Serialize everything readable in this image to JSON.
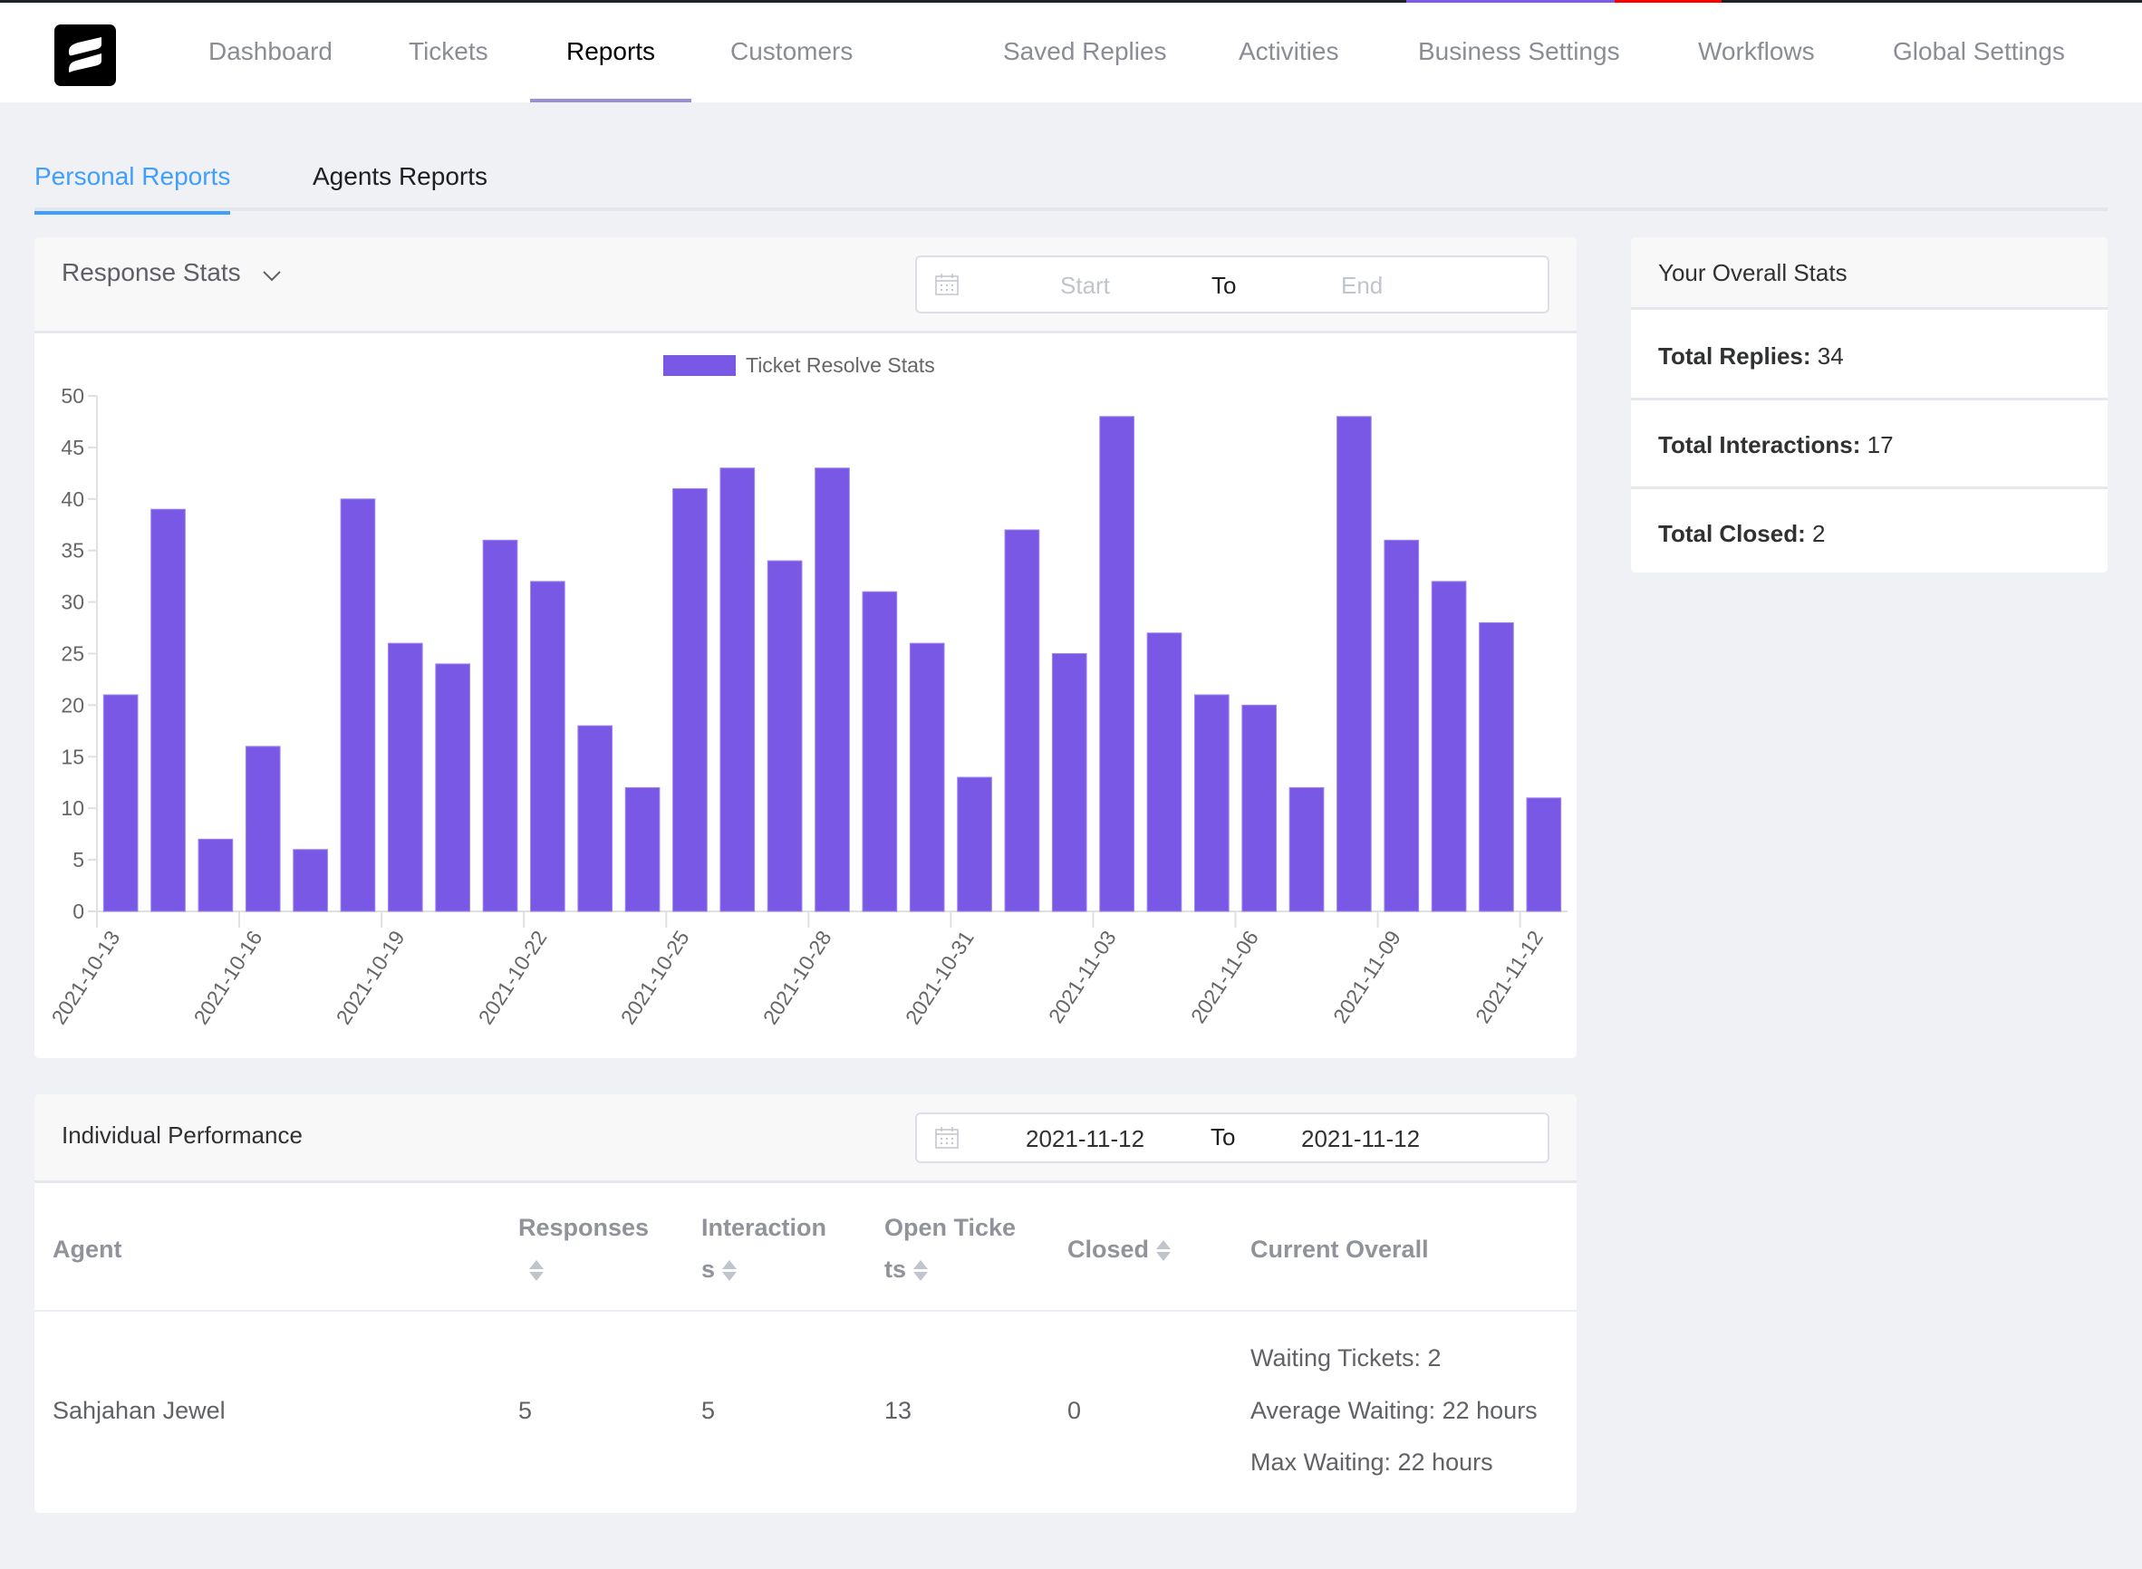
{
  "nav": {
    "logo": "fluent-support-logo",
    "items": [
      {
        "label": "Dashboard",
        "active": false
      },
      {
        "label": "Tickets",
        "active": false
      },
      {
        "label": "Reports",
        "active": true
      },
      {
        "label": "Customers",
        "active": false
      },
      {
        "label": "Saved Replies",
        "active": false
      },
      {
        "label": "Activities",
        "active": false
      },
      {
        "label": "Business Settings",
        "active": false
      },
      {
        "label": "Workflows",
        "active": false
      },
      {
        "label": "Global Settings",
        "active": false
      }
    ]
  },
  "tabs": [
    {
      "label": "Personal Reports",
      "active": true
    },
    {
      "label": "Agents Reports",
      "active": false
    }
  ],
  "response_stats": {
    "title": "Response Stats",
    "dropdown_icon": "chevron-down-icon",
    "date_range": {
      "start_placeholder": "Start",
      "separator": "To",
      "end_placeholder": "End",
      "icon": "calendar-icon"
    }
  },
  "chart_data": {
    "type": "bar",
    "title": "",
    "legend": [
      "Ticket Resolve Stats"
    ],
    "legend_position": "top",
    "xlabel": "",
    "ylabel": "",
    "ylim": [
      0,
      50
    ],
    "yticks": [
      0,
      5,
      10,
      15,
      20,
      25,
      30,
      35,
      40,
      45,
      50
    ],
    "color": "#7958e5",
    "categories": [
      "2021-10-13",
      "2021-10-14",
      "2021-10-15",
      "2021-10-16",
      "2021-10-17",
      "2021-10-18",
      "2021-10-19",
      "2021-10-20",
      "2021-10-21",
      "2021-10-22",
      "2021-10-23",
      "2021-10-24",
      "2021-10-25",
      "2021-10-26",
      "2021-10-27",
      "2021-10-28",
      "2021-10-29",
      "2021-10-30",
      "2021-10-31",
      "2021-11-01",
      "2021-11-02",
      "2021-11-03",
      "2021-11-04",
      "2021-11-05",
      "2021-11-06",
      "2021-11-07",
      "2021-11-08",
      "2021-11-09",
      "2021-11-10",
      "2021-11-11",
      "2021-11-12"
    ],
    "shown_tick_labels": [
      "2021-10-13",
      "2021-10-16",
      "2021-10-19",
      "2021-10-22",
      "2021-10-25",
      "2021-10-28",
      "2021-10-31",
      "2021-11-03",
      "2021-11-06",
      "2021-11-09",
      "2021-11-12"
    ],
    "series": [
      {
        "name": "Ticket Resolve Stats",
        "values": [
          21,
          39,
          7,
          16,
          6,
          40,
          26,
          24,
          36,
          32,
          18,
          12,
          41,
          43,
          34,
          43,
          31,
          26,
          13,
          37,
          25,
          48,
          27,
          21,
          20,
          12,
          48,
          36,
          32,
          28,
          11
        ]
      }
    ],
    "grid": false
  },
  "overall_stats": {
    "title": "Your Overall Stats",
    "rows": [
      {
        "label": "Total Replies:",
        "value": "34"
      },
      {
        "label": "Total Interactions:",
        "value": "17"
      },
      {
        "label": "Total Closed:",
        "value": "2"
      }
    ]
  },
  "individual_performance": {
    "title": "Individual Performance",
    "date_range": {
      "start": "2021-11-12",
      "separator": "To",
      "end": "2021-11-12",
      "icon": "calendar-icon"
    },
    "columns": [
      {
        "line1": "Agent",
        "line2": "",
        "sortable": false
      },
      {
        "line1": "Responses",
        "line2": "",
        "sortable": true
      },
      {
        "line1": "Interaction",
        "line2": "s",
        "sortable": true
      },
      {
        "line1": "Open Ticke",
        "line2": "ts",
        "sortable": true
      },
      {
        "line1": "Closed",
        "line2": "",
        "sortable": true
      },
      {
        "line1": "Current Overall",
        "line2": "",
        "sortable": false
      }
    ],
    "rows": [
      {
        "agent": "Sahjahan Jewel",
        "responses": "5",
        "interactions": "5",
        "open_tickets": "13",
        "closed": "0",
        "current_overall": [
          "Waiting Tickets: 2",
          "Average Waiting: 22 hours",
          "Max Waiting: 22 hours"
        ]
      }
    ]
  }
}
